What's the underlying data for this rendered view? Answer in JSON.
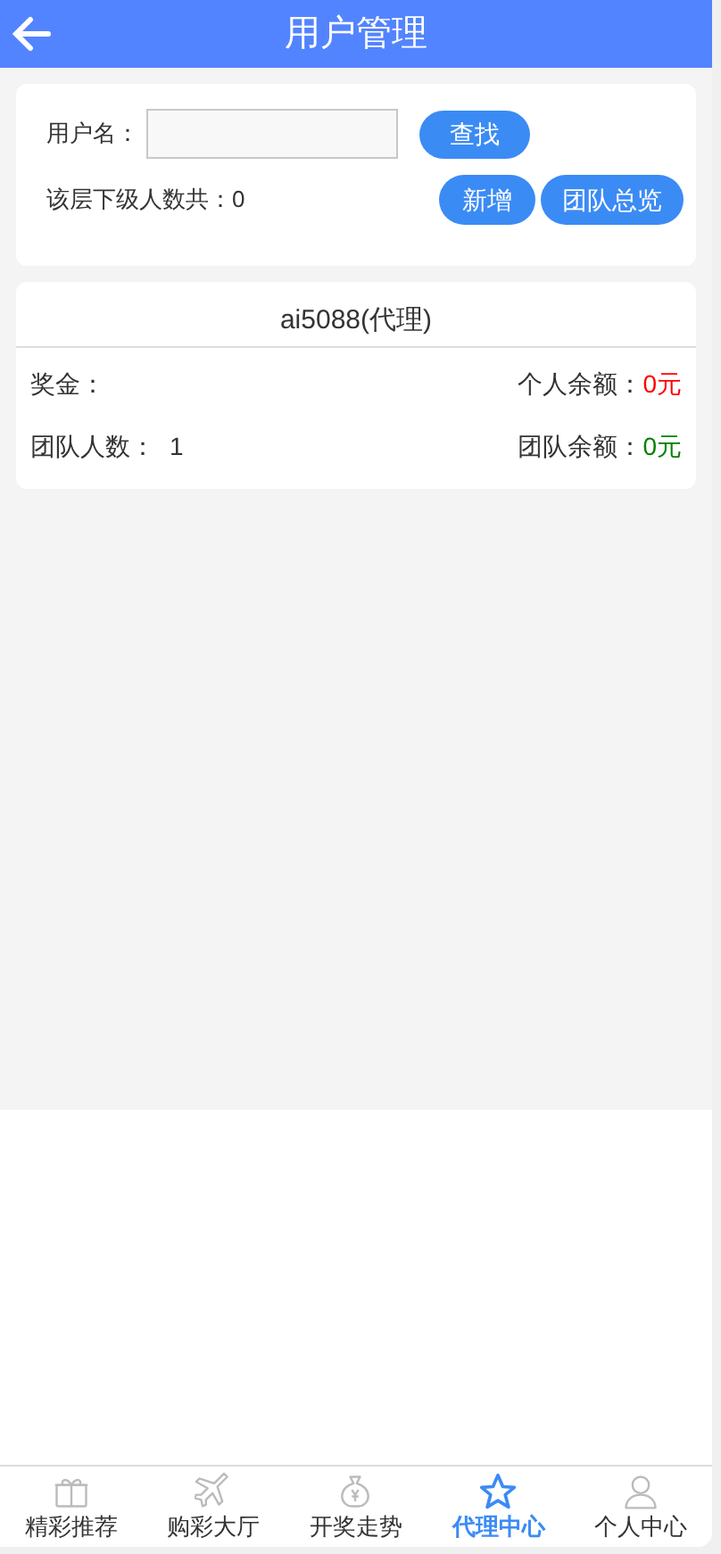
{
  "header": {
    "title": "用户管理"
  },
  "search": {
    "label": "用户名：",
    "button": "查找"
  },
  "summary": {
    "text": "该层下级人数共：0",
    "buttons": [
      "新增",
      "团队总览"
    ]
  },
  "account": {
    "title": "ai5088(代理)",
    "stats": [
      {
        "label": "奖金："
      },
      {
        "label": "个人余额：",
        "value": "0元",
        "color": "#ff0000"
      },
      {
        "label": "团队人数：",
        "value": "1"
      },
      {
        "label": "团队余额：",
        "value": "0元",
        "color": "#008000"
      }
    ]
  },
  "tabs": [
    {
      "label": "精彩推荐",
      "selected": false
    },
    {
      "label": "购彩大厅",
      "selected": false
    },
    {
      "label": "开奖走势",
      "selected": false
    },
    {
      "label": "代理中心",
      "selected": true
    },
    {
      "label": "个人中心",
      "selected": false
    }
  ]
}
